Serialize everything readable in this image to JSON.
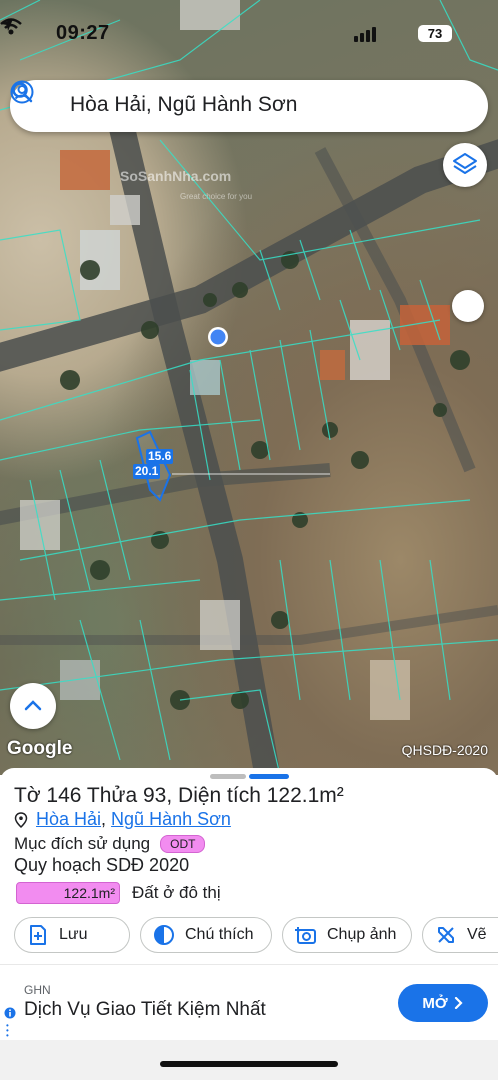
{
  "status_bar": {
    "time": "09:27",
    "battery": "73"
  },
  "search": {
    "query": "Hòa Hải, Ngũ Hành Sơn"
  },
  "map": {
    "watermark": "SoSanhNha.com",
    "watermark_sub": "Great choice for you",
    "dimension_top": "15.6",
    "dimension_side": "20.1",
    "attribution_logo": "Google",
    "layer_label": "QHSDĐ-2020"
  },
  "parcel": {
    "title": "Tờ 146 Thửa 93, Diện tích 122.1m²",
    "ward": "Hòa Hải",
    "district": "Ngũ Hành Sơn",
    "separator": ",",
    "purpose_label": "Mục đích sử dụng",
    "purpose_code": "ODT",
    "plan_title": "Quy hoạch SDĐ 2020",
    "plan_area": "122.1m²",
    "plan_desc": "Đất ở đô thị",
    "colors": {
      "odt": "#f28cf0",
      "accent": "#1a73e8"
    }
  },
  "actions": {
    "save": "Lưu",
    "legend": "Chú thích",
    "photo": "Chụp ảnh",
    "draw": "Vẽ"
  },
  "ad": {
    "brand": "GHN",
    "title": "Dịch Vụ Giao Tiết Kiệm Nhất",
    "cta": "MỞ"
  }
}
